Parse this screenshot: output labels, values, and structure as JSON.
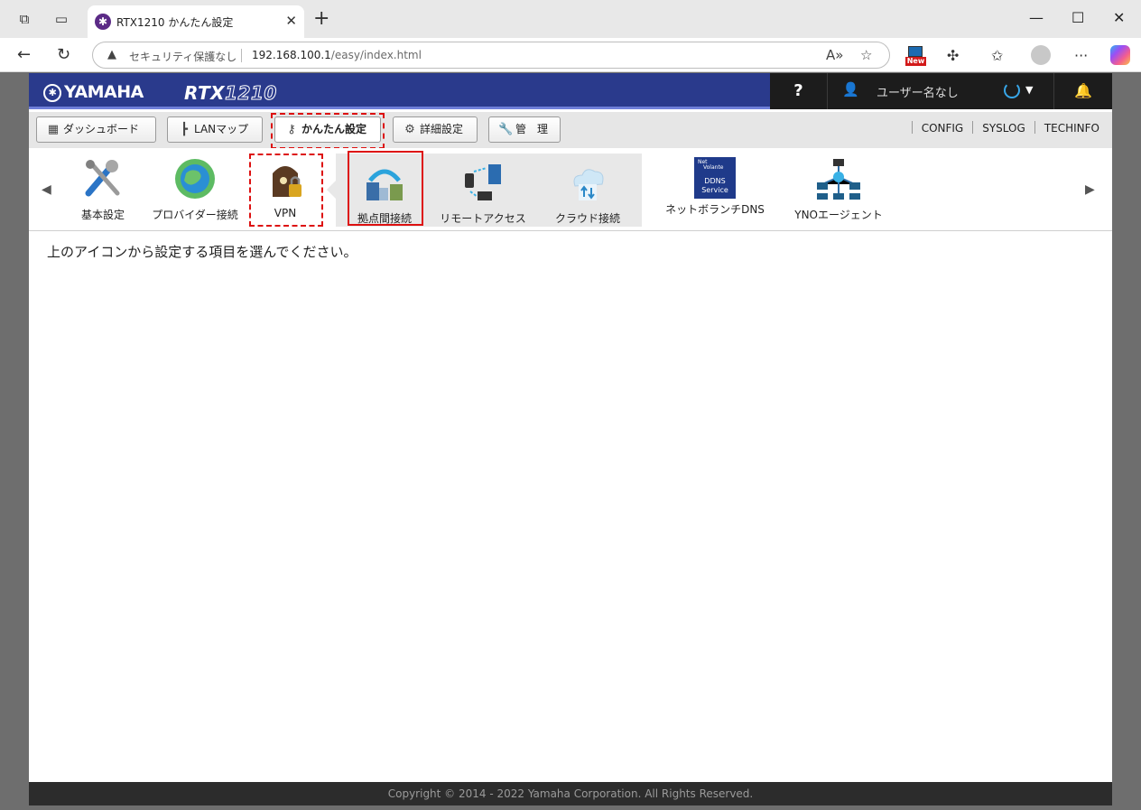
{
  "browser": {
    "tab_title": "RTX1210 かんたん設定",
    "security_label": "セキュリティ保護なし",
    "url_host": "192.168.100.1",
    "url_path": "/easy/index.html",
    "new_badge": "New"
  },
  "header": {
    "brand": "YAMAHA",
    "model_prefix": "RTX",
    "model_suffix": "1210",
    "help": "?",
    "user_name": "ユーザー名なし"
  },
  "menu": {
    "dashboard": "ダッシュボード",
    "lanmap": "LANマップ",
    "easy": "かんたん設定",
    "advanced": "詳細設定",
    "admin": "管　理",
    "links": [
      "CONFIG",
      "SYSLOG",
      "TECHINFO"
    ]
  },
  "icons": {
    "basic": "基本設定",
    "provider": "プロバイダー接続",
    "vpn": "VPN",
    "site": "拠点間接続",
    "remote": "リモートアクセス",
    "cloud": "クラウド接続",
    "netvolante": "ネットボランチDNS",
    "yno": "YNOエージェント",
    "ddns_text1": "Net",
    "ddns_text2": "Volante",
    "ddns_text3": "DDNS",
    "ddns_text4": "Service"
  },
  "message": "上のアイコンから設定する項目を選んでください。",
  "footer": "Copyright © 2014 - 2022 Yamaha Corporation. All Rights Reserved."
}
